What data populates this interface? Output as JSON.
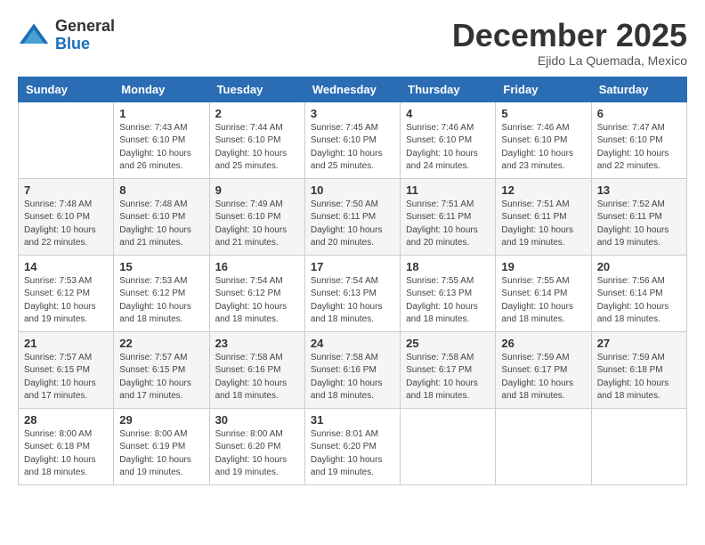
{
  "header": {
    "logo_line1": "General",
    "logo_line2": "Blue",
    "month_title": "December 2025",
    "subtitle": "Ejido La Quemada, Mexico"
  },
  "days_of_week": [
    "Sunday",
    "Monday",
    "Tuesday",
    "Wednesday",
    "Thursday",
    "Friday",
    "Saturday"
  ],
  "weeks": [
    [
      {
        "day": "",
        "info": ""
      },
      {
        "day": "1",
        "info": "Sunrise: 7:43 AM\nSunset: 6:10 PM\nDaylight: 10 hours\nand 26 minutes."
      },
      {
        "day": "2",
        "info": "Sunrise: 7:44 AM\nSunset: 6:10 PM\nDaylight: 10 hours\nand 25 minutes."
      },
      {
        "day": "3",
        "info": "Sunrise: 7:45 AM\nSunset: 6:10 PM\nDaylight: 10 hours\nand 25 minutes."
      },
      {
        "day": "4",
        "info": "Sunrise: 7:46 AM\nSunset: 6:10 PM\nDaylight: 10 hours\nand 24 minutes."
      },
      {
        "day": "5",
        "info": "Sunrise: 7:46 AM\nSunset: 6:10 PM\nDaylight: 10 hours\nand 23 minutes."
      },
      {
        "day": "6",
        "info": "Sunrise: 7:47 AM\nSunset: 6:10 PM\nDaylight: 10 hours\nand 22 minutes."
      }
    ],
    [
      {
        "day": "7",
        "info": "Sunrise: 7:48 AM\nSunset: 6:10 PM\nDaylight: 10 hours\nand 22 minutes."
      },
      {
        "day": "8",
        "info": "Sunrise: 7:48 AM\nSunset: 6:10 PM\nDaylight: 10 hours\nand 21 minutes."
      },
      {
        "day": "9",
        "info": "Sunrise: 7:49 AM\nSunset: 6:10 PM\nDaylight: 10 hours\nand 21 minutes."
      },
      {
        "day": "10",
        "info": "Sunrise: 7:50 AM\nSunset: 6:11 PM\nDaylight: 10 hours\nand 20 minutes."
      },
      {
        "day": "11",
        "info": "Sunrise: 7:51 AM\nSunset: 6:11 PM\nDaylight: 10 hours\nand 20 minutes."
      },
      {
        "day": "12",
        "info": "Sunrise: 7:51 AM\nSunset: 6:11 PM\nDaylight: 10 hours\nand 19 minutes."
      },
      {
        "day": "13",
        "info": "Sunrise: 7:52 AM\nSunset: 6:11 PM\nDaylight: 10 hours\nand 19 minutes."
      }
    ],
    [
      {
        "day": "14",
        "info": "Sunrise: 7:53 AM\nSunset: 6:12 PM\nDaylight: 10 hours\nand 19 minutes."
      },
      {
        "day": "15",
        "info": "Sunrise: 7:53 AM\nSunset: 6:12 PM\nDaylight: 10 hours\nand 18 minutes."
      },
      {
        "day": "16",
        "info": "Sunrise: 7:54 AM\nSunset: 6:12 PM\nDaylight: 10 hours\nand 18 minutes."
      },
      {
        "day": "17",
        "info": "Sunrise: 7:54 AM\nSunset: 6:13 PM\nDaylight: 10 hours\nand 18 minutes."
      },
      {
        "day": "18",
        "info": "Sunrise: 7:55 AM\nSunset: 6:13 PM\nDaylight: 10 hours\nand 18 minutes."
      },
      {
        "day": "19",
        "info": "Sunrise: 7:55 AM\nSunset: 6:14 PM\nDaylight: 10 hours\nand 18 minutes."
      },
      {
        "day": "20",
        "info": "Sunrise: 7:56 AM\nSunset: 6:14 PM\nDaylight: 10 hours\nand 18 minutes."
      }
    ],
    [
      {
        "day": "21",
        "info": "Sunrise: 7:57 AM\nSunset: 6:15 PM\nDaylight: 10 hours\nand 17 minutes."
      },
      {
        "day": "22",
        "info": "Sunrise: 7:57 AM\nSunset: 6:15 PM\nDaylight: 10 hours\nand 17 minutes."
      },
      {
        "day": "23",
        "info": "Sunrise: 7:58 AM\nSunset: 6:16 PM\nDaylight: 10 hours\nand 18 minutes."
      },
      {
        "day": "24",
        "info": "Sunrise: 7:58 AM\nSunset: 6:16 PM\nDaylight: 10 hours\nand 18 minutes."
      },
      {
        "day": "25",
        "info": "Sunrise: 7:58 AM\nSunset: 6:17 PM\nDaylight: 10 hours\nand 18 minutes."
      },
      {
        "day": "26",
        "info": "Sunrise: 7:59 AM\nSunset: 6:17 PM\nDaylight: 10 hours\nand 18 minutes."
      },
      {
        "day": "27",
        "info": "Sunrise: 7:59 AM\nSunset: 6:18 PM\nDaylight: 10 hours\nand 18 minutes."
      }
    ],
    [
      {
        "day": "28",
        "info": "Sunrise: 8:00 AM\nSunset: 6:18 PM\nDaylight: 10 hours\nand 18 minutes."
      },
      {
        "day": "29",
        "info": "Sunrise: 8:00 AM\nSunset: 6:19 PM\nDaylight: 10 hours\nand 19 minutes."
      },
      {
        "day": "30",
        "info": "Sunrise: 8:00 AM\nSunset: 6:20 PM\nDaylight: 10 hours\nand 19 minutes."
      },
      {
        "day": "31",
        "info": "Sunrise: 8:01 AM\nSunset: 6:20 PM\nDaylight: 10 hours\nand 19 minutes."
      },
      {
        "day": "",
        "info": ""
      },
      {
        "day": "",
        "info": ""
      },
      {
        "day": "",
        "info": ""
      }
    ]
  ]
}
